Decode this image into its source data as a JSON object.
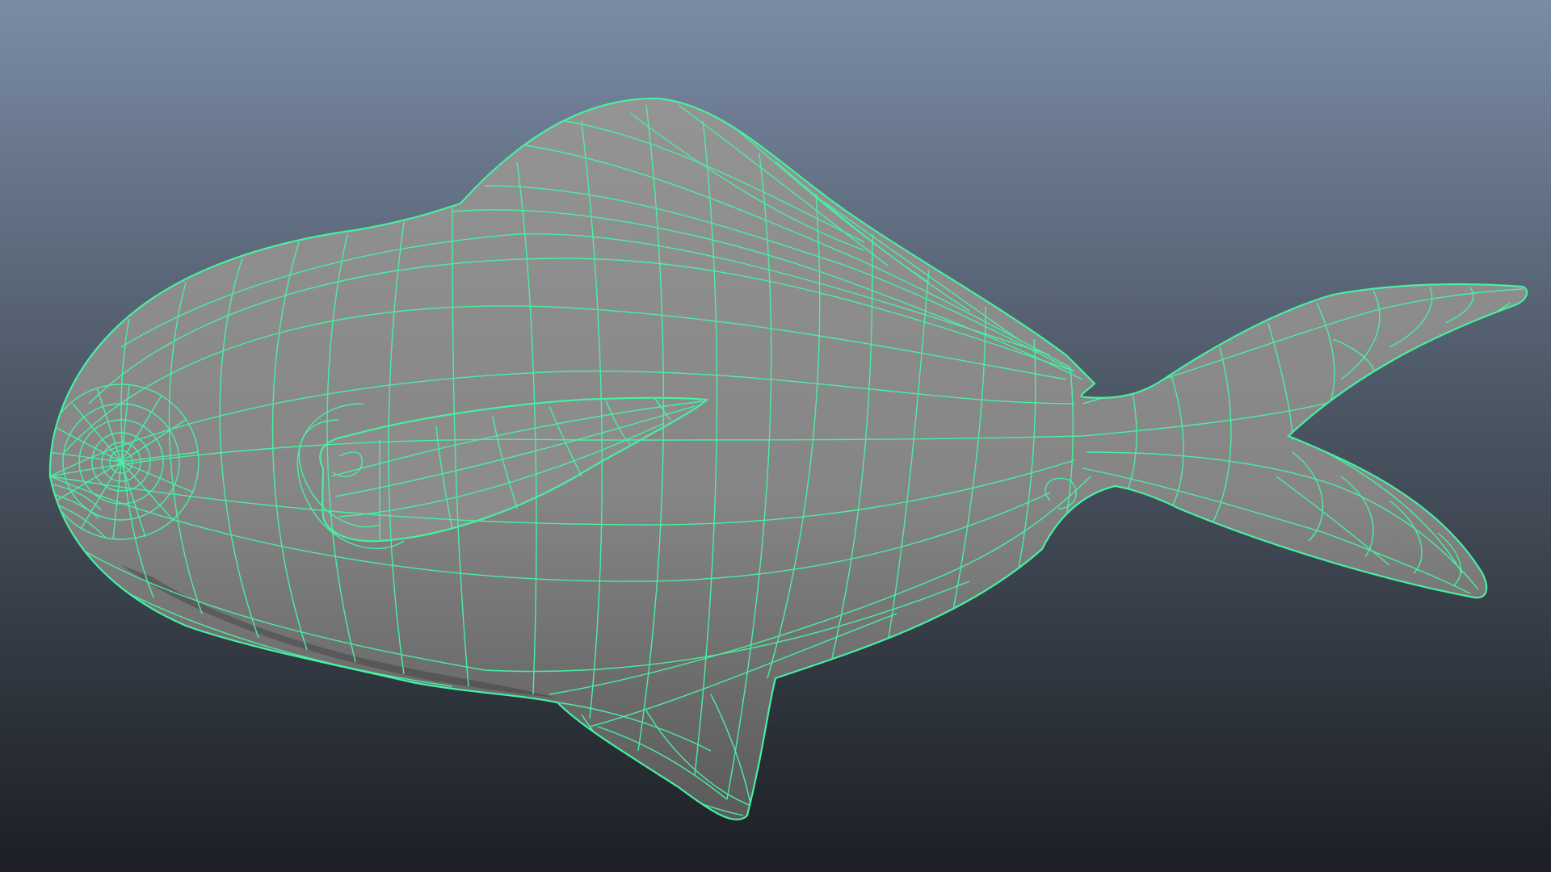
{
  "viewport": {
    "name": "3d-viewport",
    "background": {
      "top": "#7a8ba5",
      "mid": "#4d5866",
      "bottom": "#1c1f24"
    }
  },
  "model": {
    "name": "fish-mesh",
    "display_mode": "shaded-wireframe",
    "surface_color": "#858585",
    "surface_highlight": "#949494",
    "surface_shadow": "#5a5a5a",
    "wireframe_color": "#47f0a3"
  }
}
